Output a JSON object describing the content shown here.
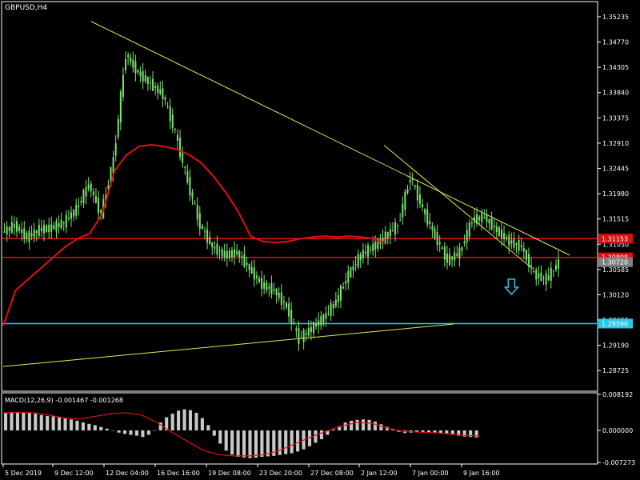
{
  "window": {
    "title": "GBPUSD,H4"
  },
  "colors": {
    "background": "#000000",
    "candle": "#7be36f",
    "ma": "#e01010",
    "trendline": "#e8e84a",
    "support": "#29c8e8",
    "hline": "#e01010",
    "macd_hist": "#c8c8c8",
    "macd_signal": "#e01010",
    "frame": "#ffffff",
    "arrow": "#29c8e8"
  },
  "price_axis": {
    "ticks": [
      "1.35235",
      "1.34770",
      "1.34305",
      "1.33840",
      "1.33375",
      "1.32910",
      "1.32445",
      "1.31980",
      "1.31515",
      "1.31050",
      "1.30585",
      "1.30120",
      "1.29655",
      "1.29190",
      "1.28725"
    ],
    "tags": [
      {
        "name": "upper-red-level",
        "value": 1.31153,
        "label": "1.31153",
        "color": "#e01010"
      },
      {
        "name": "lower-red-level",
        "value": 1.30808,
        "label": "1.30808",
        "color": "#e01010"
      },
      {
        "name": "current-price",
        "value": 1.3072,
        "label": "1.30720",
        "color": "#808080"
      },
      {
        "name": "support-level",
        "value": 1.2959,
        "label": "1.29590",
        "color": "#29c8e8"
      }
    ]
  },
  "time_axis": {
    "labels": [
      "5 Dec 2019",
      "9 Dec 12:00",
      "12 Dec 04:00",
      "16 Dec 16:00",
      "19 Dec 08:00",
      "23 Dec 20:00",
      "27 Dec 08:00",
      "2 Jan 12:00",
      "7 Jan 00:00",
      "9 Jan 16:00"
    ]
  },
  "macd": {
    "label": "MACD(12,26,9) -0.001467 -0.001268",
    "ticks": [
      "0.008192",
      "0.000000",
      "-0.007273"
    ]
  },
  "chart_data": [
    {
      "type": "candlestick",
      "title": "GBPUSD,H4",
      "ylim": [
        1.28375,
        1.35485
      ],
      "x": [
        "5 Dec 2019",
        "9 Dec 12:00",
        "12 Dec 04:00",
        "16 Dec 16:00",
        "19 Dec 08:00",
        "23 Dec 20:00",
        "27 Dec 08:00",
        "2 Jan 12:00",
        "7 Jan 00:00",
        "9 Jan 16:00"
      ],
      "close_path": [
        [
          0,
          1.3126
        ],
        [
          0.5,
          1.314
        ],
        [
          1,
          1.3118
        ],
        [
          1.5,
          1.3132
        ],
        [
          2,
          1.3135
        ],
        [
          2.5,
          1.3145
        ],
        [
          3,
          1.317
        ],
        [
          3.5,
          1.3215
        ],
        [
          4,
          1.316
        ],
        [
          4.5,
          1.326
        ],
        [
          5,
          1.3455
        ],
        [
          5.5,
          1.342
        ],
        [
          6,
          1.34
        ],
        [
          6.5,
          1.338
        ],
        [
          7,
          1.331
        ],
        [
          7.5,
          1.322
        ],
        [
          8,
          1.314
        ],
        [
          8.5,
          1.31
        ],
        [
          9,
          1.3085
        ],
        [
          9.5,
          1.309
        ],
        [
          10,
          1.306
        ],
        [
          10.5,
          1.303
        ],
        [
          11,
          1.302
        ],
        [
          11.5,
          1.299
        ],
        [
          12,
          1.293
        ],
        [
          12.5,
          1.295
        ],
        [
          13,
          1.297
        ],
        [
          13.5,
          1.3
        ],
        [
          14,
          1.305
        ],
        [
          14.5,
          1.3085
        ],
        [
          15,
          1.31
        ],
        [
          15.5,
          1.312
        ],
        [
          16,
          1.314
        ],
        [
          16.5,
          1.323
        ],
        [
          17,
          1.317
        ],
        [
          17.5,
          1.312
        ],
        [
          18,
          1.3075
        ],
        [
          18.5,
          1.309
        ],
        [
          19,
          1.315
        ],
        [
          19.5,
          1.3155
        ],
        [
          20,
          1.313
        ],
        [
          20.5,
          1.311
        ],
        [
          21,
          1.31
        ],
        [
          21.5,
          1.305
        ],
        [
          22,
          1.304
        ],
        [
          22.5,
          1.3072
        ]
      ],
      "ma_path": [
        [
          0,
          1.2955
        ],
        [
          0.5,
          1.302
        ],
        [
          1,
          1.304
        ],
        [
          1.5,
          1.306
        ],
        [
          2,
          1.308
        ],
        [
          2.5,
          1.31
        ],
        [
          3,
          1.3115
        ],
        [
          3.5,
          1.3125
        ],
        [
          4,
          1.316
        ],
        [
          4.5,
          1.324
        ],
        [
          5,
          1.327
        ],
        [
          5.5,
          1.3285
        ],
        [
          6,
          1.3288
        ],
        [
          6.5,
          1.3285
        ],
        [
          7,
          1.328
        ],
        [
          7.5,
          1.327
        ],
        [
          8,
          1.3255
        ],
        [
          8.5,
          1.323
        ],
        [
          9,
          1.32
        ],
        [
          9.5,
          1.3165
        ],
        [
          10,
          1.312
        ],
        [
          10.5,
          1.311
        ],
        [
          11,
          1.3108
        ],
        [
          11.5,
          1.311
        ],
        [
          12,
          1.3115
        ],
        [
          12.5,
          1.3118
        ],
        [
          13,
          1.312
        ],
        [
          13.5,
          1.3118
        ],
        [
          14,
          1.312
        ],
        [
          14.5,
          1.3118
        ],
        [
          15,
          1.3115
        ],
        [
          15.5,
          1.3105
        ]
      ],
      "hlines": [
        {
          "name": "upper-red-level",
          "value": 1.31153
        },
        {
          "name": "lower-red-level",
          "value": 1.30808
        },
        {
          "name": "support-level",
          "value": 1.2959
        }
      ],
      "trendlines": [
        {
          "name": "main-descending-trendline",
          "from": [
            3.55,
            1.3515
          ],
          "to": [
            22.9,
            1.3085
          ]
        },
        {
          "name": "second-descending-trendline",
          "from": [
            15.4,
            1.3287
          ],
          "to": [
            21.4,
            1.306
          ]
        },
        {
          "name": "rising-support-trendline",
          "from": [
            0,
            1.288
          ],
          "to": [
            18.2,
            1.2958
          ]
        }
      ],
      "signal_arrow": {
        "x": 20.55,
        "y": 1.302,
        "direction": "down"
      }
    },
    {
      "type": "bar",
      "title": "MACD(12,26,9) -0.001467 -0.001268",
      "ylim": [
        -0.007273,
        0.008192
      ],
      "histogram": [
        0.004,
        0.0041,
        0.0042,
        0.0041,
        0.004,
        0.0038,
        0.0035,
        0.0033,
        0.0032,
        0.003,
        0.0028,
        0.0025,
        0.0022,
        0.0018,
        0.0015,
        0.0012,
        0.0008,
        0.0004,
        0.0,
        -0.0005,
        -0.0008,
        -0.001,
        -0.0012,
        -0.0015,
        -0.001,
        0.0,
        0.0018,
        0.003,
        0.0038,
        0.0045,
        0.0048,
        0.0046,
        0.004,
        0.0028,
        0.0012,
        -0.0012,
        -0.003,
        -0.0046,
        -0.0055,
        -0.006,
        -0.0062,
        -0.0063,
        -0.0062,
        -0.006,
        -0.0059,
        -0.0058,
        -0.0056,
        -0.0054,
        -0.0052,
        -0.0048,
        -0.0043,
        -0.0036,
        -0.0028,
        -0.002,
        -0.001,
        0.0002,
        0.001,
        0.0018,
        0.0022,
        0.0024,
        0.0025,
        0.0024,
        0.002,
        0.0014,
        0.0008,
        0.0003,
        -0.0003,
        -0.0006,
        -0.0005,
        -0.0003,
        -0.0004,
        -0.0005,
        -0.0006,
        -0.0007,
        -0.0008,
        -0.001,
        -0.0012,
        -0.0014,
        -0.0015,
        -0.0016
      ],
      "signal_path": [
        [
          0,
          0.004
        ],
        [
          1,
          0.0041
        ],
        [
          2,
          0.004
        ],
        [
          3,
          0.0035
        ],
        [
          4,
          0.0028
        ],
        [
          5,
          0.0026
        ],
        [
          6,
          0.0032
        ],
        [
          7,
          0.0038
        ],
        [
          8,
          0.004
        ],
        [
          9,
          0.0035
        ],
        [
          10,
          0.0018
        ],
        [
          11,
          -0.0005
        ],
        [
          12,
          -0.0025
        ],
        [
          13,
          -0.0045
        ],
        [
          14,
          -0.0055
        ],
        [
          15,
          -0.0058
        ],
        [
          16,
          -0.0058
        ],
        [
          17,
          -0.0055
        ],
        [
          18,
          -0.0045
        ],
        [
          19,
          -0.003
        ],
        [
          20,
          -0.0015
        ],
        [
          21,
          -0.0002
        ],
        [
          22,
          0.001
        ],
        [
          23,
          0.0018
        ],
        [
          24,
          0.0016
        ],
        [
          25,
          0.0005
        ],
        [
          26,
          -0.0002
        ],
        [
          27,
          -0.0004
        ],
        [
          28,
          -0.0005
        ],
        [
          29,
          -0.0008
        ],
        [
          30,
          -0.0011
        ],
        [
          31,
          -0.0013
        ]
      ]
    }
  ]
}
